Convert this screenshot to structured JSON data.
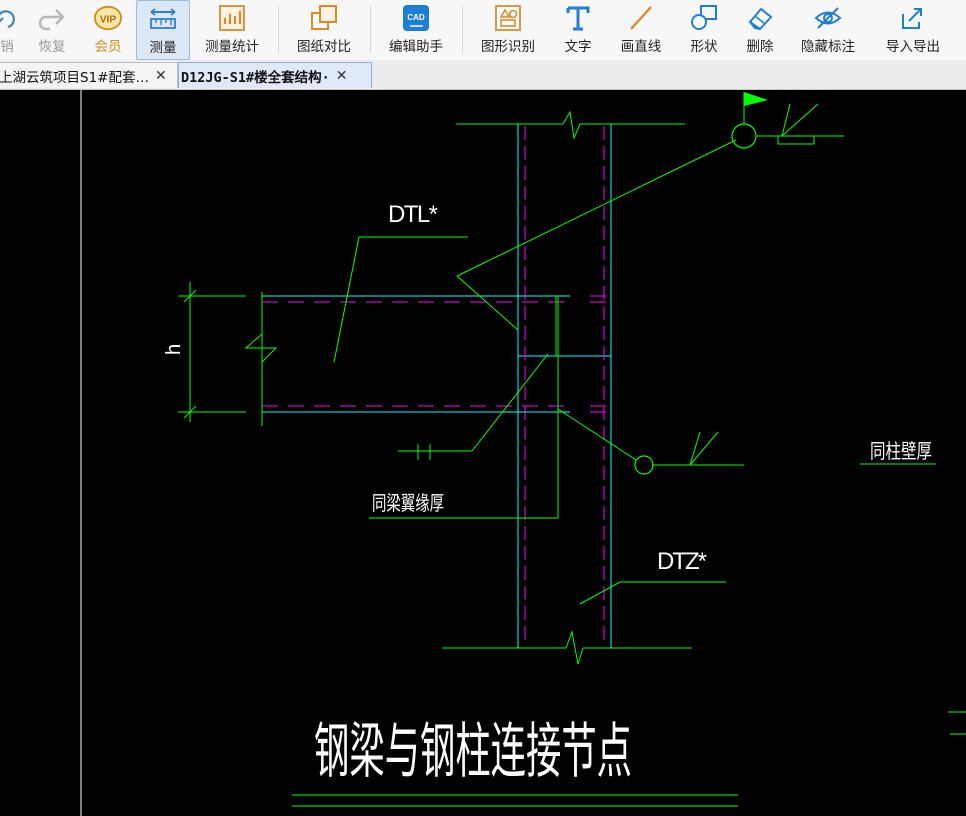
{
  "toolbar": {
    "items": [
      {
        "label": "销",
        "icon": "undo-icon"
      },
      {
        "label": "恢复",
        "icon": "redo-icon"
      },
      {
        "label": "会员",
        "icon": "vip-icon",
        "icon_text": "VIP"
      },
      {
        "label": "测量",
        "icon": "measure-icon"
      },
      {
        "label": "测量统计",
        "icon": "measure-stats-icon"
      },
      {
        "label": "图纸对比",
        "icon": "compare-icon"
      },
      {
        "label": "编辑助手",
        "icon": "cad-edit-icon",
        "icon_text": "CAD"
      },
      {
        "label": "图形识别",
        "icon": "shape-recognize-icon"
      },
      {
        "label": "文字",
        "icon": "text-icon"
      },
      {
        "label": "画直线",
        "icon": "line-icon"
      },
      {
        "label": "形状",
        "icon": "shape-icon"
      },
      {
        "label": "删除",
        "icon": "eraser-icon"
      },
      {
        "label": "隐藏标注",
        "icon": "hide-eye-icon"
      },
      {
        "label": "导入导出",
        "icon": "import-export-icon"
      }
    ]
  },
  "tabs": [
    {
      "title": "上湖云筑项目S1#配套…",
      "close": "✕",
      "active": false
    },
    {
      "title": "D12JG-S1#楼全套结构·",
      "close": "✕",
      "active": true
    }
  ],
  "drawing": {
    "labels": {
      "beam": "DTL*",
      "column": "DTZ*",
      "height": "h",
      "flange_note": "同梁翼缘厚",
      "wall_note": "同柱壁厚"
    },
    "title": "钢梁与钢柱连接节点",
    "colors": {
      "background": "#000000",
      "green": "#00ff00",
      "cyan": "#00ffff",
      "magenta": "#ff00ff",
      "white": "#ffffff",
      "flag": "#00ff00",
      "accent": "#2f7fd6"
    }
  }
}
